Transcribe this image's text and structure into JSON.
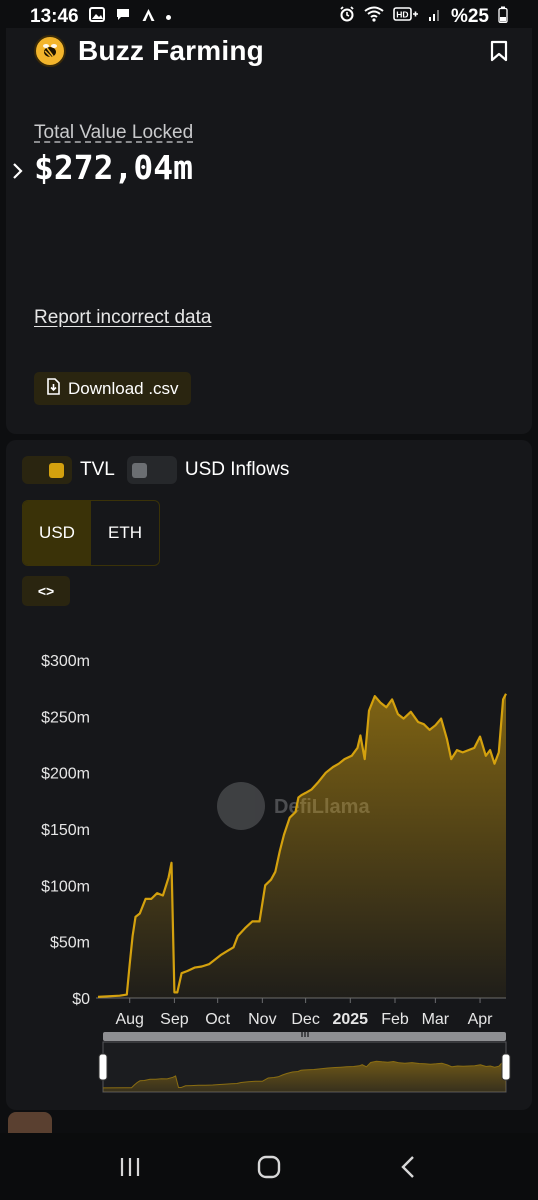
{
  "status_bar": {
    "time": "13:46",
    "battery": "%25"
  },
  "protocol": {
    "name": "Buzz Farming"
  },
  "tvl": {
    "label": "Total Value Locked",
    "value": "$272,04m"
  },
  "links": {
    "report": "Report incorrect data",
    "download": "Download .csv"
  },
  "legend": [
    {
      "label": "TVL",
      "color": "#d4a10e",
      "enabled": true
    },
    {
      "label": "USD Inflows",
      "color": "#6b6e72",
      "enabled": false
    }
  ],
  "denomination": {
    "options": [
      "USD",
      "ETH"
    ],
    "selected": "USD"
  },
  "embed": {
    "label": "<>"
  },
  "colors": {
    "accent": "#d4a10e",
    "card": "#16171a",
    "background": "#0d0e10"
  },
  "chart_data": {
    "type": "area",
    "series": [
      {
        "name": "TVL",
        "color": "#d4a10e"
      }
    ],
    "yticks": [
      "$300m",
      "$250m",
      "$200m",
      "$150m",
      "$100m",
      "$50m",
      "$0"
    ],
    "ylim": [
      0,
      300
    ],
    "xticks": [
      "Aug",
      "Sep",
      "Oct",
      "Nov",
      "Dec",
      "2025",
      "Feb",
      "Mar",
      "Apr"
    ],
    "x": [
      "2024-07-10",
      "2024-07-25",
      "2024-07-30",
      "2024-08-01",
      "2024-08-03",
      "2024-08-05",
      "2024-08-08",
      "2024-08-12",
      "2024-08-16",
      "2024-08-20",
      "2024-08-24",
      "2024-08-28",
      "2024-08-30",
      "2024-09-01",
      "2024-09-03",
      "2024-09-06",
      "2024-09-10",
      "2024-09-15",
      "2024-09-20",
      "2024-09-25",
      "2024-09-30",
      "2024-10-03",
      "2024-10-08",
      "2024-10-12",
      "2024-10-15",
      "2024-10-20",
      "2024-10-25",
      "2024-10-30",
      "2024-11-03",
      "2024-11-07",
      "2024-11-10",
      "2024-11-13",
      "2024-11-16",
      "2024-11-20",
      "2024-11-24",
      "2024-11-26",
      "2024-11-28",
      "2024-12-01",
      "2024-12-05",
      "2024-12-10",
      "2024-12-15",
      "2024-12-20",
      "2024-12-24",
      "2024-12-28",
      "2025-01-02",
      "2025-01-06",
      "2025-01-08",
      "2025-01-11",
      "2025-01-14",
      "2025-01-18",
      "2025-01-22",
      "2025-01-26",
      "2025-01-30",
      "2025-02-03",
      "2025-02-07",
      "2025-02-12",
      "2025-02-17",
      "2025-02-21",
      "2025-02-25",
      "2025-03-01",
      "2025-03-05",
      "2025-03-09",
      "2025-03-12",
      "2025-03-16",
      "2025-03-20",
      "2025-03-24",
      "2025-03-28",
      "2025-04-01",
      "2025-04-05",
      "2025-04-08",
      "2025-04-11",
      "2025-04-14",
      "2025-04-17",
      "2025-04-19"
    ],
    "values": [
      1,
      2,
      3,
      30,
      55,
      72,
      75,
      88,
      88,
      93,
      91,
      107,
      120,
      5,
      5,
      22,
      24,
      27,
      28,
      30,
      35,
      38,
      42,
      45,
      55,
      62,
      68,
      68,
      100,
      105,
      112,
      130,
      145,
      160,
      165,
      178,
      180,
      182,
      185,
      192,
      200,
      205,
      208,
      212,
      215,
      222,
      233,
      212,
      255,
      268,
      262,
      258,
      265,
      252,
      248,
      254,
      245,
      243,
      238,
      242,
      248,
      230,
      212,
      220,
      218,
      220,
      222,
      232,
      215,
      220,
      208,
      218,
      265,
      270
    ]
  },
  "navbar": {
    "items": [
      "recent-apps",
      "home",
      "back"
    ]
  }
}
